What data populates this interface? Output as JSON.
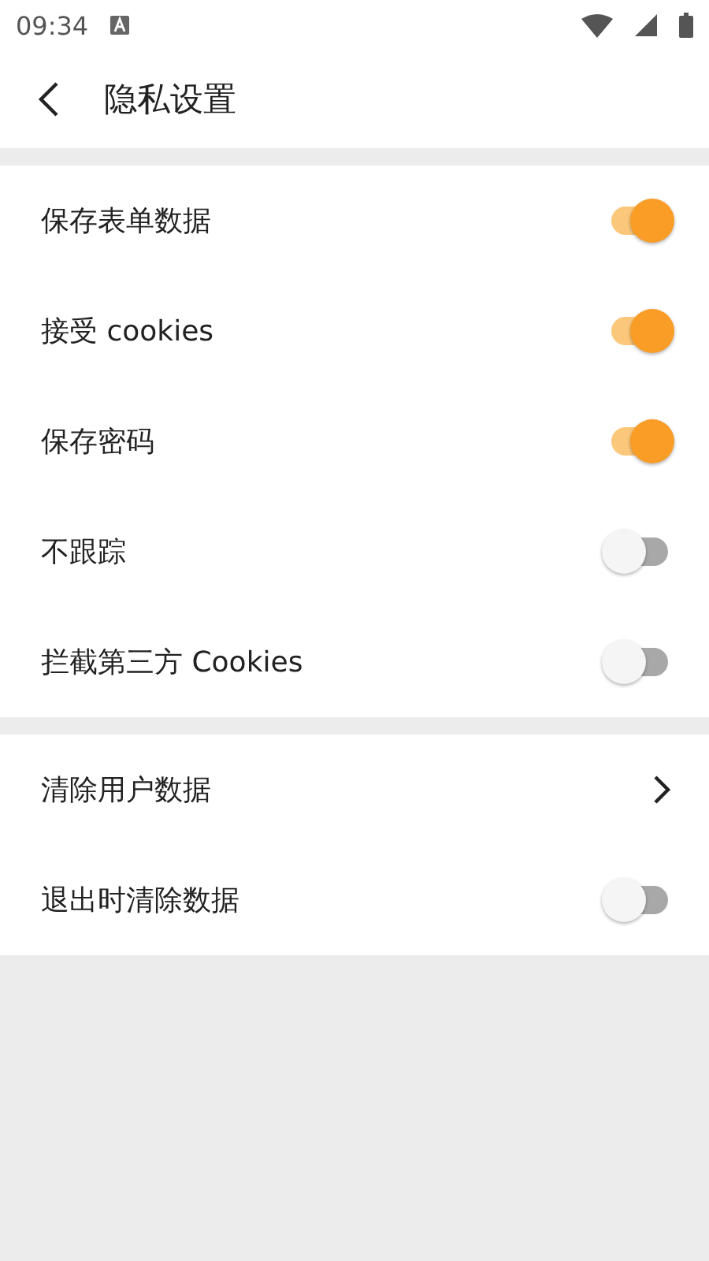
{
  "status_bar": {
    "time": "09:34"
  },
  "header": {
    "title": "隐私设置"
  },
  "sections": [
    {
      "items": [
        {
          "kind": "toggle",
          "label": "保存表单数据",
          "on": true
        },
        {
          "kind": "toggle",
          "label": "接受 cookies",
          "on": true
        },
        {
          "kind": "toggle",
          "label": "保存密码",
          "on": true
        },
        {
          "kind": "toggle",
          "label": "不跟踪",
          "on": false
        },
        {
          "kind": "toggle",
          "label": "拦截第三方 Cookies",
          "on": false
        }
      ]
    },
    {
      "items": [
        {
          "kind": "link",
          "label": "清除用户数据"
        },
        {
          "kind": "toggle",
          "label": "退出时清除数据",
          "on": false
        }
      ]
    }
  ]
}
